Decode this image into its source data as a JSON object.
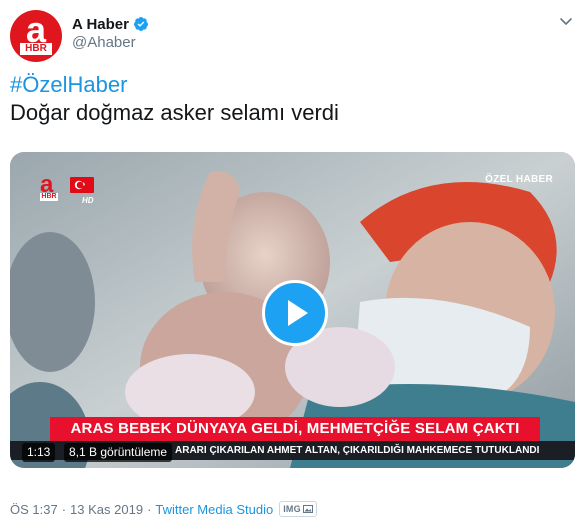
{
  "account": {
    "display_name": "A Haber",
    "handle": "@Ahaber",
    "avatar_letter": "a",
    "avatar_tag": "HBR",
    "verified": true
  },
  "tweet": {
    "hashtag": "#ÖzelHaber",
    "text": "Doğar doğmaz asker selamı verdi"
  },
  "video": {
    "logo_letter": "a",
    "logo_tag": "HBR",
    "hd": "HD",
    "corner_label": "ÖZEL HABER",
    "headline": "ARAS BEBEK DÜNYAYA GELDİ, MEHMETÇİĞE SELAM ÇAKTI",
    "ticker": "ARARI ÇIKARILAN AHMET ALTAN, ÇIKARILDIĞI MAHKEMECE TUTUKLANDI",
    "duration": "1:13",
    "views": "8,1 B görüntüleme"
  },
  "meta": {
    "time": "ÖS 1:37",
    "date": "13 Kas 2019",
    "separator": "·",
    "source": "Twitter Media Studio",
    "image_badge": "IMG"
  },
  "colors": {
    "brand_red": "#e0161e",
    "twitter_blue": "#1da1f2",
    "link_blue": "#1b95e0",
    "meta_gray": "#657786"
  },
  "icons": {
    "verified": "verified-badge-icon",
    "chevron": "chevron-down-icon",
    "play": "play-icon",
    "flag": "turkish-flag-icon",
    "img_badge": "image-badge-icon"
  }
}
